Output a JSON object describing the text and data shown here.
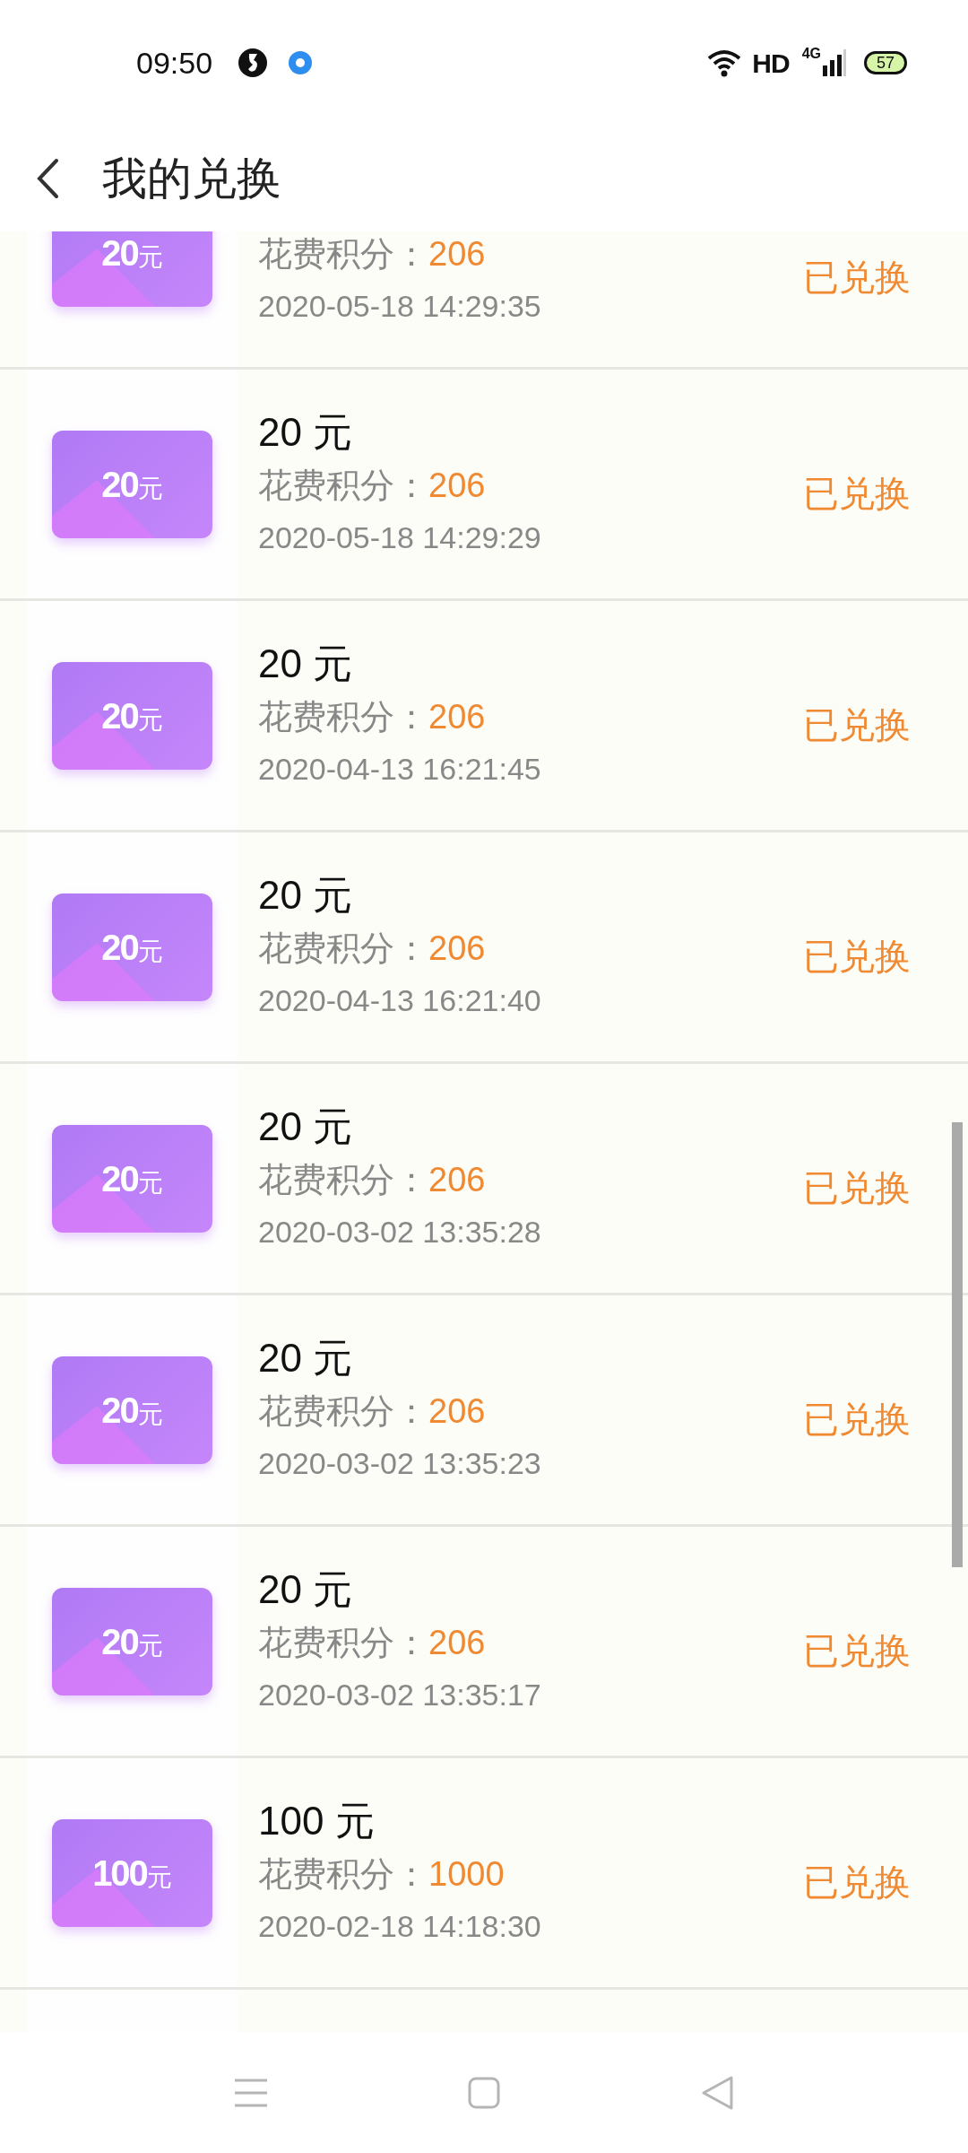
{
  "status_bar": {
    "time": "09:50",
    "network_label": "HD",
    "signal_label": "4G",
    "battery": "57"
  },
  "header": {
    "title": "我的兑换"
  },
  "items": [
    {
      "partial": true,
      "voucher_amount": "20",
      "voucher_unit": "元",
      "points_label": "花费积分：",
      "points": "206",
      "date": "2020-05-18 14:29:35",
      "status": "已兑换"
    },
    {
      "title": "20 元",
      "voucher_amount": "20",
      "voucher_unit": "元",
      "points_label": "花费积分：",
      "points": "206",
      "date": "2020-05-18 14:29:29",
      "status": "已兑换"
    },
    {
      "title": "20 元",
      "voucher_amount": "20",
      "voucher_unit": "元",
      "points_label": "花费积分：",
      "points": "206",
      "date": "2020-04-13 16:21:45",
      "status": "已兑换"
    },
    {
      "title": "20 元",
      "voucher_amount": "20",
      "voucher_unit": "元",
      "points_label": "花费积分：",
      "points": "206",
      "date": "2020-04-13 16:21:40",
      "status": "已兑换"
    },
    {
      "title": "20 元",
      "voucher_amount": "20",
      "voucher_unit": "元",
      "points_label": "花费积分：",
      "points": "206",
      "date": "2020-03-02 13:35:28",
      "status": "已兑换"
    },
    {
      "title": "20 元",
      "voucher_amount": "20",
      "voucher_unit": "元",
      "points_label": "花费积分：",
      "points": "206",
      "date": "2020-03-02 13:35:23",
      "status": "已兑换"
    },
    {
      "title": "20 元",
      "voucher_amount": "20",
      "voucher_unit": "元",
      "points_label": "花费积分：",
      "points": "206",
      "date": "2020-03-02 13:35:17",
      "status": "已兑换"
    },
    {
      "title": "100 元",
      "voucher_amount": "100",
      "voucher_unit": "元",
      "points_label": "花费积分：",
      "points": "1000",
      "date": "2020-02-18 14:18:30",
      "status": "已兑换"
    }
  ]
}
